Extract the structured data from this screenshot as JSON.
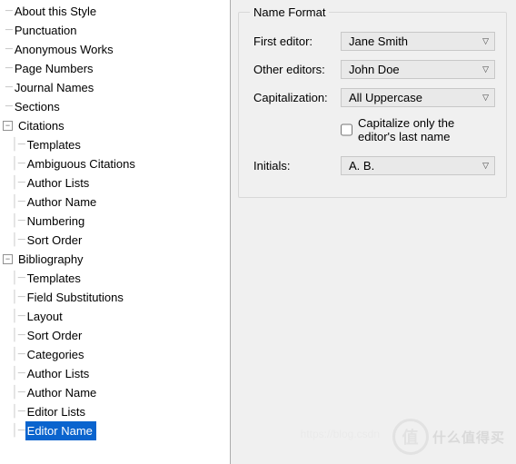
{
  "tree": {
    "top": [
      "About this Style",
      "Punctuation",
      "Anonymous Works",
      "Page Numbers",
      "Journal Names",
      "Sections"
    ],
    "citations": {
      "label": "Citations",
      "children": [
        "Templates",
        "Ambiguous Citations",
        "Author Lists",
        "Author Name",
        "Numbering",
        "Sort Order"
      ]
    },
    "bibliography": {
      "label": "Bibliography",
      "children": [
        "Templates",
        "Field Substitutions",
        "Layout",
        "Sort Order",
        "Categories",
        "Author Lists",
        "Author Name",
        "Editor Lists",
        "Editor Name"
      ],
      "selected": "Editor Name"
    }
  },
  "form": {
    "legend": "Name Format",
    "first_editor_label": "First editor:",
    "first_editor_value": "Jane Smith",
    "other_editors_label": "Other editors:",
    "other_editors_value": "John Doe",
    "capitalization_label": "Capitalization:",
    "capitalization_value": "All Uppercase",
    "checkbox_label": "Capitalize only the editor's last name",
    "checkbox_checked": false,
    "initials_label": "Initials:",
    "initials_value": "A. B."
  },
  "watermark": {
    "text": "什么值得买",
    "glyph": "值",
    "url": "https://blog.csdn"
  }
}
